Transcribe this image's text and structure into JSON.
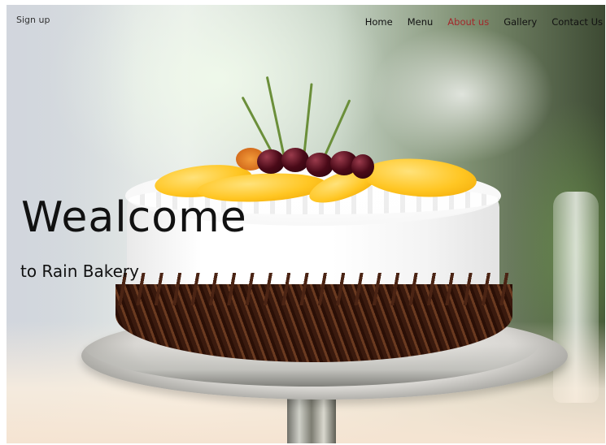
{
  "header": {
    "signup_label": "Sign up",
    "nav": [
      {
        "label": "Home",
        "active": false
      },
      {
        "label": "Menu",
        "active": false
      },
      {
        "label": "About us",
        "active": true
      },
      {
        "label": "Gallery",
        "active": false
      },
      {
        "label": "Contact Us",
        "active": false
      }
    ]
  },
  "hero": {
    "title": "Wealcome",
    "subtitle": "to Rain Bakery",
    "background_image": "cake-on-stand-photo"
  },
  "colors": {
    "active_nav": "#a3282b",
    "text": "#111111"
  }
}
